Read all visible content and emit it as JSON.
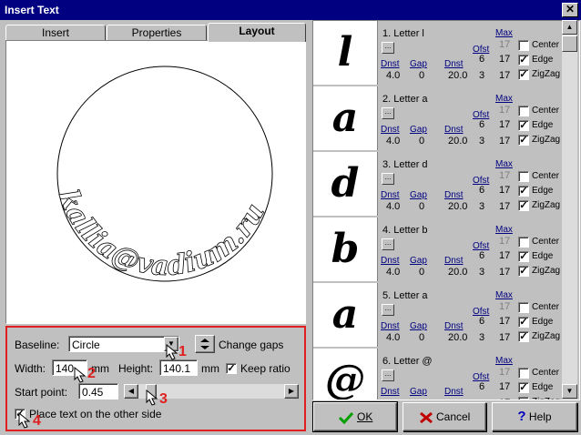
{
  "window": {
    "title": "Insert Text",
    "close_glyph": "✕"
  },
  "tabs": [
    {
      "label": "Insert",
      "active": false
    },
    {
      "label": "Properties",
      "active": false
    },
    {
      "label": "Layout",
      "active": true
    }
  ],
  "preview": {
    "sample_text": "kallia@vadium.ru"
  },
  "layout": {
    "baseline_label": "Baseline:",
    "baseline_value": "Circle",
    "change_gaps_label": "Change gaps",
    "width_label": "Width:",
    "width_value": "140",
    "width_unit": "mm",
    "height_label": "Height:",
    "height_value": "140.1",
    "height_unit": "mm",
    "keep_ratio_label": "Keep ratio",
    "keep_ratio_checked": true,
    "start_point_label": "Start point:",
    "start_point_value": "0.45",
    "start_point_fraction": 0.04,
    "other_side_label": "Place text on the other side",
    "other_side_checked": true
  },
  "callouts": [
    "1",
    "2",
    "3",
    "4"
  ],
  "letters": [
    {
      "glyph": "l",
      "title": "1. Letter l",
      "dnst": "4.0",
      "gap": "0",
      "dnst2": "20.0",
      "ofst_a": "6",
      "ofst_b": "3",
      "max_a": "17",
      "max_b": "17",
      "center": false,
      "edge": true,
      "zigzag": true
    },
    {
      "glyph": "a",
      "title": "2. Letter a",
      "dnst": "4.0",
      "gap": "0",
      "dnst2": "20.0",
      "ofst_a": "6",
      "ofst_b": "3",
      "max_a": "17",
      "max_b": "17",
      "center": false,
      "edge": true,
      "zigzag": true
    },
    {
      "glyph": "d",
      "title": "3. Letter d",
      "dnst": "4.0",
      "gap": "0",
      "dnst2": "20.0",
      "ofst_a": "6",
      "ofst_b": "3",
      "max_a": "17",
      "max_b": "17",
      "center": false,
      "edge": true,
      "zigzag": true
    },
    {
      "glyph": "b",
      "title": "4. Letter b",
      "dnst": "4.0",
      "gap": "0",
      "dnst2": "20.0",
      "ofst_a": "6",
      "ofst_b": "3",
      "max_a": "17",
      "max_b": "17",
      "center": false,
      "edge": true,
      "zigzag": true
    },
    {
      "glyph": "a",
      "title": "5. Letter a",
      "dnst": "4.0",
      "gap": "0",
      "dnst2": "20.0",
      "ofst_a": "6",
      "ofst_b": "3",
      "max_a": "17",
      "max_b": "17",
      "center": false,
      "edge": true,
      "zigzag": true
    },
    {
      "glyph": "@",
      "title": "6. Letter @",
      "dnst": "",
      "gap": "",
      "dnst2": "",
      "ofst_a": "6",
      "ofst_b": "",
      "max_a": "17",
      "max_b": "17",
      "center": false,
      "edge": true,
      "zigzag": false
    }
  ],
  "letter_headers": {
    "max": "Max",
    "ofst": "Ofst",
    "dnst": "Dnst",
    "gap": "Gap",
    "center": "Center",
    "edge": "Edge",
    "zigzag": "ZigZag"
  },
  "buttons": {
    "ok": "OK",
    "cancel": "Cancel",
    "help": "Help"
  }
}
